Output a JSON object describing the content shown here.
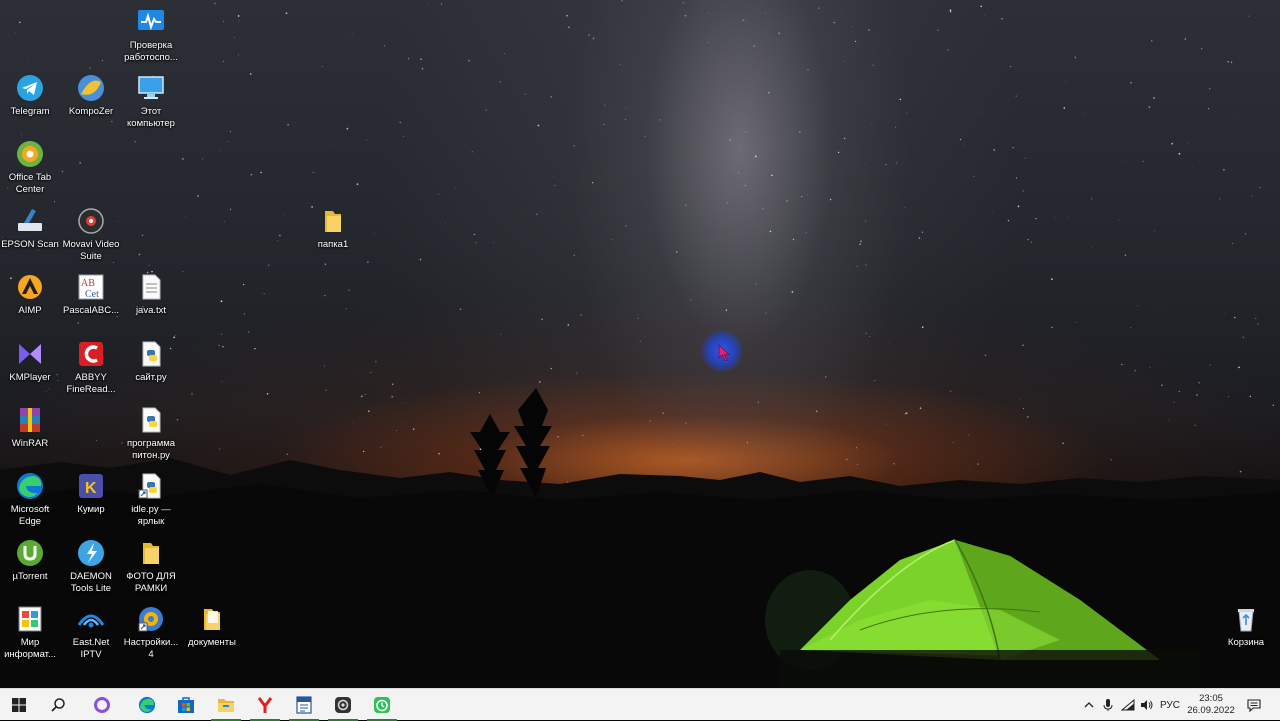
{
  "desktop_icons": [
    {
      "label": "Проверка работоспо...",
      "icon": "health-check-icon"
    },
    {
      "label": "Telegram",
      "icon": "telegram-icon"
    },
    {
      "label": "KompoZer",
      "icon": "kompozer-icon"
    },
    {
      "label": "Этот компьютер",
      "icon": "this-pc-icon"
    },
    {
      "label": "Office Tab Center",
      "icon": "office-tab-icon"
    },
    {
      "label": "EPSON Scan",
      "icon": "epson-scan-icon"
    },
    {
      "label": "Movavi Video Suite",
      "icon": "movavi-icon"
    },
    {
      "label": "папка1",
      "icon": "folder-icon"
    },
    {
      "label": "AIMP",
      "icon": "aimp-icon"
    },
    {
      "label": "PascalABC...",
      "icon": "pascalabc-icon"
    },
    {
      "label": "java.txt",
      "icon": "text-file-icon"
    },
    {
      "label": "KMPlayer",
      "icon": "kmplayer-icon"
    },
    {
      "label": "ABBYY FineRead...",
      "icon": "abbyy-icon"
    },
    {
      "label": "сайт.py",
      "icon": "python-file-icon"
    },
    {
      "label": "WinRAR",
      "icon": "winrar-icon"
    },
    {
      "label": "программа питон.ру",
      "icon": "python-file-icon"
    },
    {
      "label": "Microsoft Edge",
      "icon": "edge-icon"
    },
    {
      "label": "Кумир",
      "icon": "kumir-icon"
    },
    {
      "label": "idle.py — ярлык",
      "icon": "python-shortcut-icon"
    },
    {
      "label": "µTorrent",
      "icon": "utorrent-icon"
    },
    {
      "label": "DAEMON Tools Lite",
      "icon": "daemon-tools-icon"
    },
    {
      "label": "ФОТО ДЛЯ РАМКИ",
      "icon": "folder-icon"
    },
    {
      "label": "Мир информат...",
      "icon": "mir-informatiki-icon"
    },
    {
      "label": "East.Net IPTV",
      "icon": "iptv-icon"
    },
    {
      "label": "Настройки... 4",
      "icon": "settings-icon"
    },
    {
      "label": "документы",
      "icon": "folder-icon"
    },
    {
      "label": "Корзина",
      "icon": "recycle-bin-icon"
    }
  ],
  "taskbar": {
    "buttons": [
      "start-icon",
      "search-icon",
      "cortana-icon",
      "edge-icon",
      "store-icon",
      "file-explorer-icon",
      "yandex-browser-icon",
      "word-doc-icon",
      "camera-app-icon",
      "screen-recorder-icon"
    ],
    "tray_icons": [
      "chevron-up-icon",
      "microphone-icon",
      "wifi-icon",
      "volume-icon"
    ],
    "language": "РУС",
    "time": "23:05",
    "date": "26.09.2022",
    "notifications_icon": "action-center-icon"
  },
  "colors": {
    "taskbar_bg": "#f3f3f3",
    "tent_green": "#7bd22a",
    "horizon_orange": "#e66e1e",
    "cursor_highlight": "#2a5cff"
  }
}
